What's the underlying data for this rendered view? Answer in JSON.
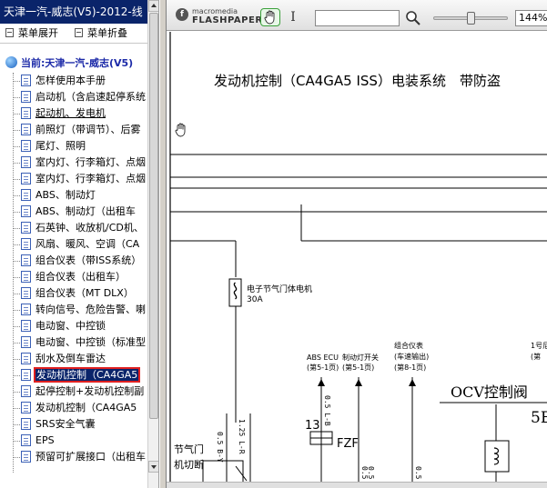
{
  "left_panel": {
    "title": "天津一汽-威志(V5)-2012-线",
    "menu": {
      "expand_label": "菜单展开",
      "collapse_label": "菜单折叠"
    },
    "tree": {
      "root_label": "当前:天津一汽-威志(V5)",
      "items": [
        {
          "label": "怎样使用本手册"
        },
        {
          "label": "启动机（含启速起停系统"
        },
        {
          "label": "起动机、发电机"
        },
        {
          "label": "前照灯（带调节）、后雾"
        },
        {
          "label": "尾灯、照明"
        },
        {
          "label": "室内灯、行李箱灯、点烟"
        },
        {
          "label": "室内灯、行李箱灯、点烟"
        },
        {
          "label": "ABS、制动灯"
        },
        {
          "label": "ABS、制动灯（出租车"
        },
        {
          "label": "石英钟、收放机/CD机、"
        },
        {
          "label": "风扇、暖风、空调（CA"
        },
        {
          "label": "组合仪表（带ISS系统）"
        },
        {
          "label": "组合仪表（出租车）"
        },
        {
          "label": "组合仪表（MT DLX）"
        },
        {
          "label": "转向信号、危险告警、喇"
        },
        {
          "label": "电动窗、中控锁"
        },
        {
          "label": "电动窗、中控锁（标准型"
        },
        {
          "label": "刮水及倒车雷达"
        },
        {
          "label": "发动机控制（CA4GA5"
        },
        {
          "label": "起停控制+发动机控制副"
        },
        {
          "label": "发动机控制（CA4GA5"
        },
        {
          "label": "SRS安全气囊"
        },
        {
          "label": "EPS"
        },
        {
          "label": "预留可扩展接口（出租车"
        }
      ]
    }
  },
  "toolbar": {
    "brand_top": "macromedia",
    "brand_bottom": "FLASHPAPER",
    "hand_tool_icon": "hand-icon",
    "select_tool_icon": "text-select-icon",
    "search_value": "",
    "zoom_value": "144%"
  },
  "document": {
    "title": "发动机控制（CA4GA5 ISS）电装系统　带防盗",
    "fuse_label_1": "电子节气门体电机",
    "fuse_label_2": "30A",
    "abs_ecu_1": "ABS ECU",
    "abs_ecu_2": "(第5-1页)",
    "brake_switch_1": "制动灯开关",
    "brake_switch_2": "(第5-1页)",
    "combo_meter_1": "组合仪表",
    "combo_meter_2": "(车速输出)",
    "combo_meter_3": "(第8-1页)",
    "right_col_1": "1号尼",
    "right_col_2": "(第",
    "ocv_label": "OCV控制阀",
    "number_5e": "5E",
    "number_13": "13",
    "fzf_label": "FZF",
    "wire_05by": "0.5 B-Y",
    "wire_125lr": "1.25 L-R",
    "wire_05_1": "0.5",
    "wire_05_2": "0.5",
    "wire_05_3": "0.5",
    "wire_05lb": "0.5 L-B",
    "throttle_1": "节气门",
    "throttle_2": "机切断"
  }
}
